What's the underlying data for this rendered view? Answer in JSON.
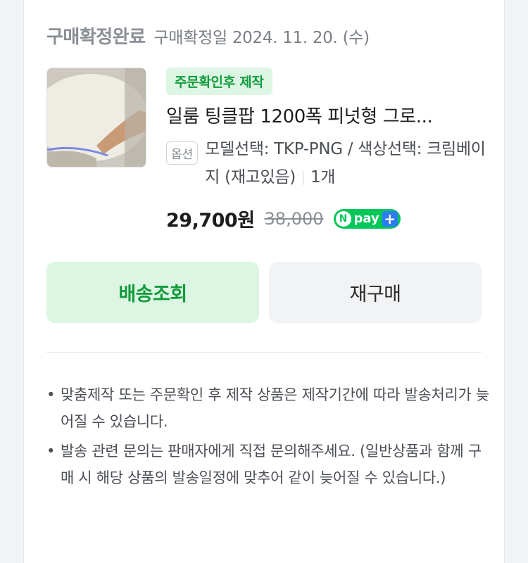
{
  "order": {
    "status": "구매확정완료",
    "date_text": "구매확정일 2024. 11. 20. (수)"
  },
  "product": {
    "badge": "주문확인후 제작",
    "name": "일룸 팅클팝 1200폭 피넛형 그로...",
    "option_chip": "옵션",
    "option_text": "모델선택: TKP-PNG / 색상선택: 크림베이지 (재고있음)",
    "quantity": "1개",
    "price": "29,700원",
    "original_price": "38,000",
    "pay_badge_n": "N",
    "pay_badge_text": "pay",
    "pay_badge_plus": "+"
  },
  "buttons": {
    "track": "배송조회",
    "reorder": "재구매"
  },
  "notes": [
    "맞춤제작 또는 주문확인 후 제작 상품은 제작기간에 따라 발송처리가 늦어질 수 있습니다.",
    "발송 관련 문의는 판매자에게 직접 문의해주세요. (일반상품과 함께 구매 시 해당 상품의 발송일정에 맞추어 같이 늦어질 수 있습니다.)"
  ],
  "notes_bullet": "•",
  "colors": {
    "accent_green": "#139a3d",
    "accent_green_bg": "#dcf6e3",
    "npay_green": "#03c75a"
  }
}
